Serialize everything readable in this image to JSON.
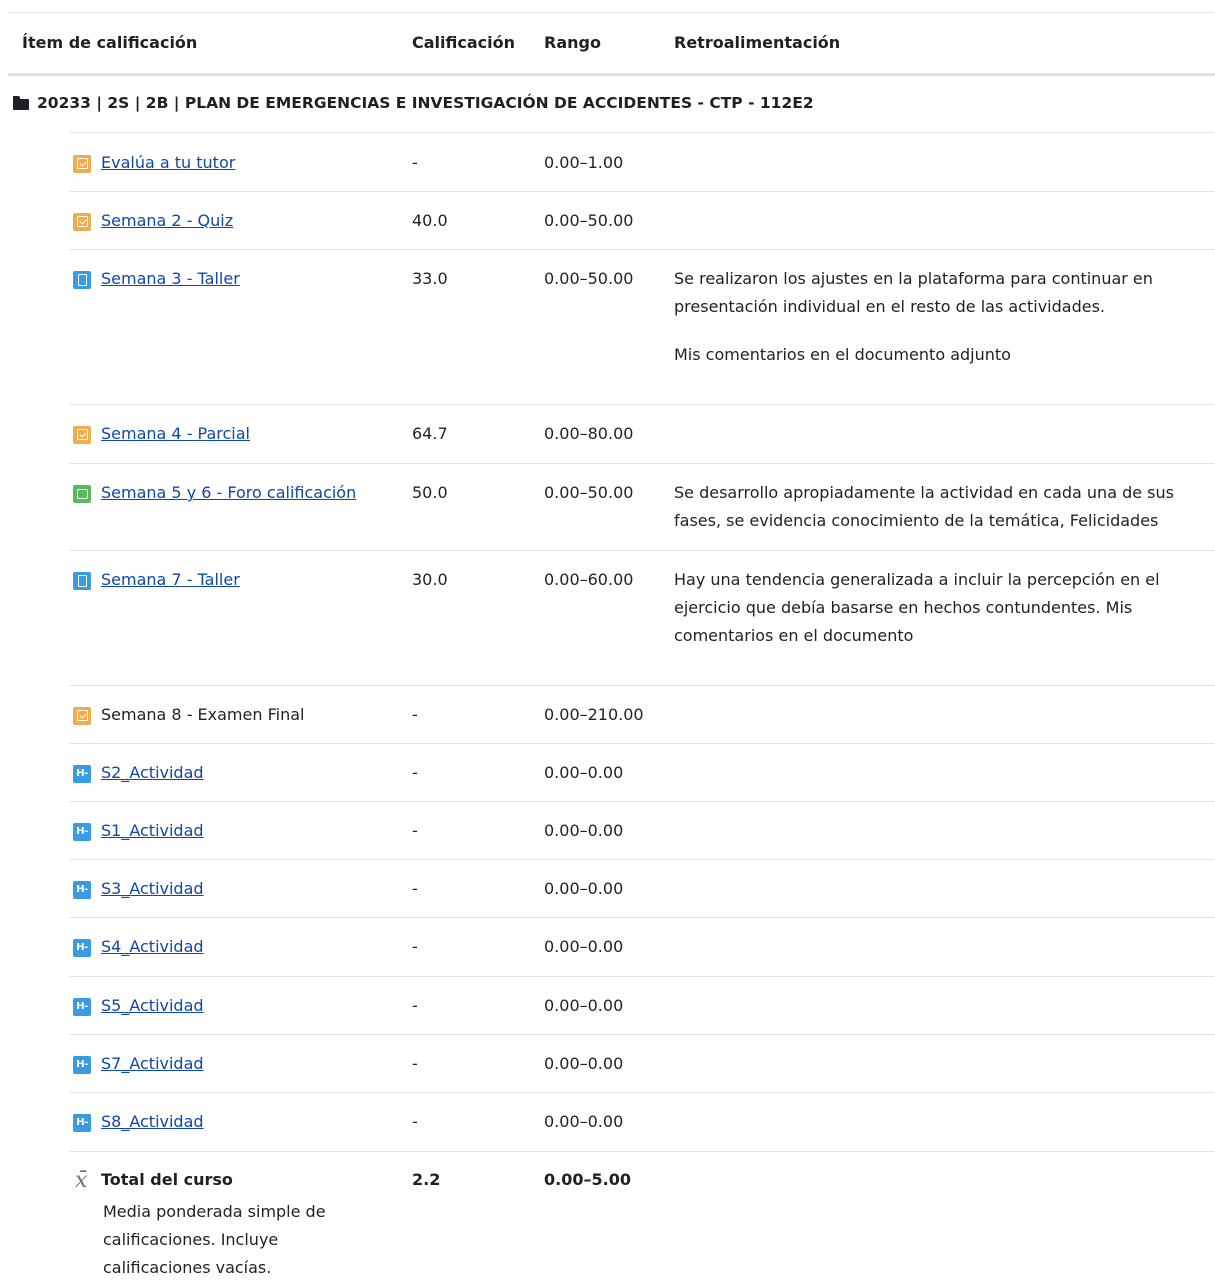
{
  "header": {
    "item": "Ítem de calificación",
    "grade": "Calificación",
    "range": "Rango",
    "feedback": "Retroalimentación"
  },
  "category": {
    "icon": "folder-icon",
    "name": "20233 | 2S | 2B | PLAN DE EMERGENCIAS E INVESTIGACIÓN DE ACCIDENTES - CTP - 112E2"
  },
  "items": [
    {
      "icon": "quiz-icon",
      "name": "Evalúa a tu tutor",
      "grade": "-",
      "range": "0.00–1.00",
      "feedback": []
    },
    {
      "icon": "quiz-icon",
      "name": "Semana 2 - Quiz",
      "grade": "40.0",
      "range": "0.00–50.00",
      "feedback": []
    },
    {
      "icon": "assignment-icon",
      "name": "Semana 3 - Taller",
      "grade": "33.0",
      "range": "0.00–50.00",
      "feedback": [
        "Se realizaron los ajustes en la plataforma para continuar en presentación individual en el resto de las actividades.",
        "Mis comentarios en el documento adjunto"
      ]
    },
    {
      "icon": "quiz-icon",
      "name": "Semana 4 - Parcial",
      "grade": "64.7",
      "range": "0.00–80.00",
      "feedback": []
    },
    {
      "icon": "forum-icon",
      "name": "Semana 5 y 6 - Foro calificación",
      "grade": "50.0",
      "range": "0.00–50.00",
      "feedback": [
        "Se desarrollo apropiadamente la actividad en cada una de sus fases, se evidencia conocimiento de la temática, Felicidades"
      ]
    },
    {
      "icon": "assignment-icon",
      "name": "Semana 7 - Taller",
      "grade": "30.0",
      "range": "0.00–60.00",
      "feedback": [
        "Hay una tendencia generalizada a incluir la percepción en el ejercicio que debía basarse en hechos contundentes.  Mis comentarios en el documento"
      ]
    },
    {
      "icon": "quiz-icon",
      "name": "Semana 8 - Examen Final",
      "grade": "-",
      "range": "0.00–210.00",
      "feedback": []
    },
    {
      "icon": "h5p-icon",
      "name": "S2_Actividad",
      "grade": "-",
      "range": "0.00–0.00",
      "feedback": []
    },
    {
      "icon": "h5p-icon",
      "name": "S1_Actividad",
      "grade": "-",
      "range": "0.00–0.00",
      "feedback": []
    },
    {
      "icon": "h5p-icon",
      "name": "S3_Actividad",
      "grade": "-",
      "range": "0.00–0.00",
      "feedback": []
    },
    {
      "icon": "h5p-icon",
      "name": "S4_Actividad",
      "grade": "-",
      "range": "0.00–0.00",
      "feedback": []
    },
    {
      "icon": "h5p-icon",
      "name": "S5_Actividad",
      "grade": "-",
      "range": "0.00–0.00",
      "feedback": []
    },
    {
      "icon": "h5p-icon",
      "name": "S7_Actividad",
      "grade": "-",
      "range": "0.00–0.00",
      "feedback": []
    },
    {
      "icon": "h5p-icon",
      "name": "S8_Actividad",
      "grade": "-",
      "range": "0.00–0.00",
      "feedback": []
    }
  ],
  "h5p_label": "H-P",
  "total": {
    "icon": "mean-icon",
    "symbol": "x̄",
    "title": "Total del curso",
    "description": "Media ponderada simple de calificaciones. Incluye calificaciones vacías.",
    "grade": "2.2",
    "range": "0.00–5.00"
  }
}
